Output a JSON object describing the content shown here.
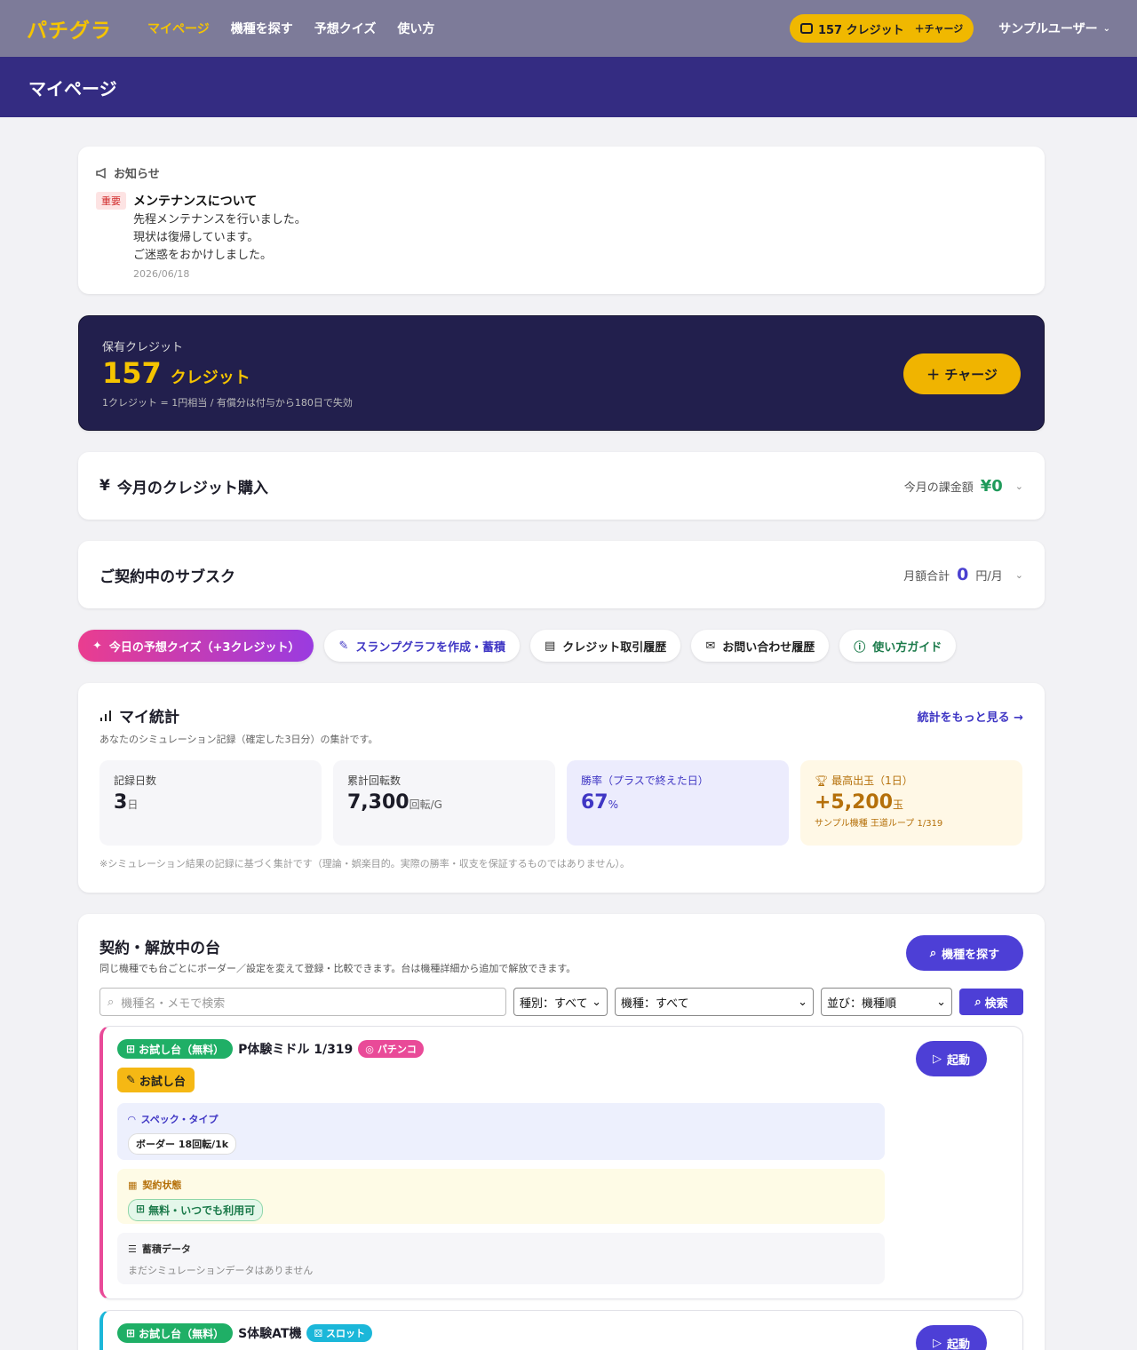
{
  "nav": {
    "logo": "パチグラ",
    "links": [
      "マイページ",
      "機種を探す",
      "予想クイズ",
      "使い方"
    ],
    "credit_amount": "157 クレジット",
    "credit_charge": "＋チャージ",
    "user": "サンプルユーザー"
  },
  "page_title": "マイページ",
  "notice": {
    "heading": "お知らせ",
    "tag": "重要",
    "title": "メンテナンスについて",
    "lines": [
      "先程メンテナンスを行いました。",
      "現状は復帰しています。",
      "ご迷惑をおかけしました。"
    ],
    "date": "2026/06/18"
  },
  "credit": {
    "label": "保有クレジット",
    "amount": "157",
    "unit": "クレジット",
    "note": "1クレジット = 1円相当 / 有償分は付与から180日で失効",
    "charge": "＋ チャージ"
  },
  "purchase": {
    "title": "今月のクレジット購入",
    "right_label": "今月の課金額",
    "value": "¥0"
  },
  "subscription": {
    "title": "ご契約中のサブスク",
    "right_label": "月額合計",
    "value": "0",
    "unit": "円/月"
  },
  "chips": {
    "quiz": "今日の予想クイズ（+3クレジット）",
    "graph": "スランプグラフを作成・蓄積",
    "history": "クレジット取引履歴",
    "inquiry": "お問い合わせ履歴",
    "guide": "使い方ガイド"
  },
  "stats": {
    "title": "マイ統計",
    "subtitle": "あなたのシミュレーション記録（確定した3日分）の集計です。",
    "more": "統計をもっと見る →",
    "items": [
      {
        "label": "記録日数",
        "value": "3",
        "unit": "日"
      },
      {
        "label": "累計回転数",
        "value": "7,300",
        "unit": "回転/G"
      },
      {
        "label": "勝率（プラスで終えた日）",
        "value": "67",
        "unit": "%"
      },
      {
        "label": "最高出玉（1日）",
        "value": "+5,200",
        "unit": "玉",
        "sub": "サンプル機種 王道ループ 1/319"
      }
    ],
    "disclaimer": "※シミュレーション結果の記録に基づく集計です（理論・娯楽目的。実際の勝率・収支を保証するものではありません）。"
  },
  "machines": {
    "title": "契約・解放中の台",
    "subtitle": "同じ機種でも台ごとにボーダー／設定を変えて登録・比較できます。台は機種詳細から追加で解放できます。",
    "find": "機種を探す",
    "search_placeholder": "機種名・メモで検索",
    "filter_type": "種別：すべて",
    "filter_model": "機種：すべて",
    "filter_sort": "並び：機種順",
    "search_button": "検索",
    "items": [
      {
        "badge": "お試し台（無料）",
        "name": "P体験ミドル 1/319",
        "kind": "パチンコ",
        "memo": "お試し台",
        "launch": "起動",
        "spec_label": "スペック・タイプ",
        "spec_value": "ボーダー 18回転/1k",
        "contract_label": "契約状態",
        "contract_value": "無料・いつでも利用可",
        "accum_label": "蓄積データ",
        "accum_value": "まだシミュレーションデータはありません"
      },
      {
        "badge": "お試し台（無料）",
        "name": "S体験AT機",
        "kind": "スロット",
        "launch": "起動"
      }
    ]
  },
  "colors": {
    "nav_bg": "#7d7b99",
    "band_bg": "#342c82",
    "accent_yellow": "#f5c400",
    "accent_indigo": "#4d3fd6",
    "pink": "#e94a98",
    "cyan": "#1bb7d9",
    "green": "#1faf66"
  }
}
